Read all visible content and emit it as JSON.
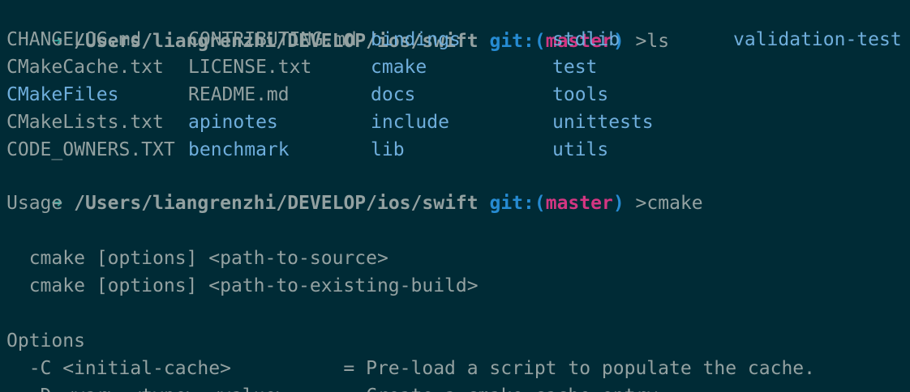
{
  "prompt": {
    "arrow": "➜",
    "path": "/Users/liangrenzhi/DEVELOP/ios/swift",
    "git_label": "git:",
    "paren_open": "(",
    "branch": "master",
    "paren_close": ")"
  },
  "commands": [
    "ls",
    "cmake"
  ],
  "colors": {
    "background": "#002b36",
    "text": "#93a1a1",
    "directory": "#6faedc",
    "git": "#268bd2",
    "branch": "#d33682",
    "arrow": "#2aa198"
  },
  "ls_rows": [
    [
      {
        "name": "CHANGELOG.md",
        "kind": "file"
      },
      {
        "name": "CONTRIBUTING.md",
        "kind": "file"
      },
      {
        "name": "bindings",
        "kind": "dir"
      },
      {
        "name": "stdlib",
        "kind": "dir"
      },
      {
        "name": "validation-test",
        "kind": "dir"
      }
    ],
    [
      {
        "name": "CMakeCache.txt",
        "kind": "file"
      },
      {
        "name": "LICENSE.txt",
        "kind": "file"
      },
      {
        "name": "cmake",
        "kind": "dir"
      },
      {
        "name": "test",
        "kind": "dir"
      }
    ],
    [
      {
        "name": "CMakeFiles",
        "kind": "dir"
      },
      {
        "name": "README.md",
        "kind": "file"
      },
      {
        "name": "docs",
        "kind": "dir"
      },
      {
        "name": "tools",
        "kind": "dir"
      }
    ],
    [
      {
        "name": "CMakeLists.txt",
        "kind": "file"
      },
      {
        "name": "apinotes",
        "kind": "dir"
      },
      {
        "name": "include",
        "kind": "dir"
      },
      {
        "name": "unittests",
        "kind": "dir"
      }
    ],
    [
      {
        "name": "CODE_OWNERS.TXT",
        "kind": "file"
      },
      {
        "name": "benchmark",
        "kind": "dir"
      },
      {
        "name": "lib",
        "kind": "dir"
      },
      {
        "name": "utils",
        "kind": "dir"
      }
    ]
  ],
  "cmake_output": {
    "usage_heading": "Usage",
    "usage_lines": [
      "  cmake [options] <path-to-source>",
      "  cmake [options] <path-to-existing-build>"
    ],
    "options_heading": "Options",
    "option_lines": [
      "  -C <initial-cache>          = Pre-load a script to populate the cache.",
      "  -D <var>:<type>=<value>     = Create a cmake cache entry."
    ]
  }
}
